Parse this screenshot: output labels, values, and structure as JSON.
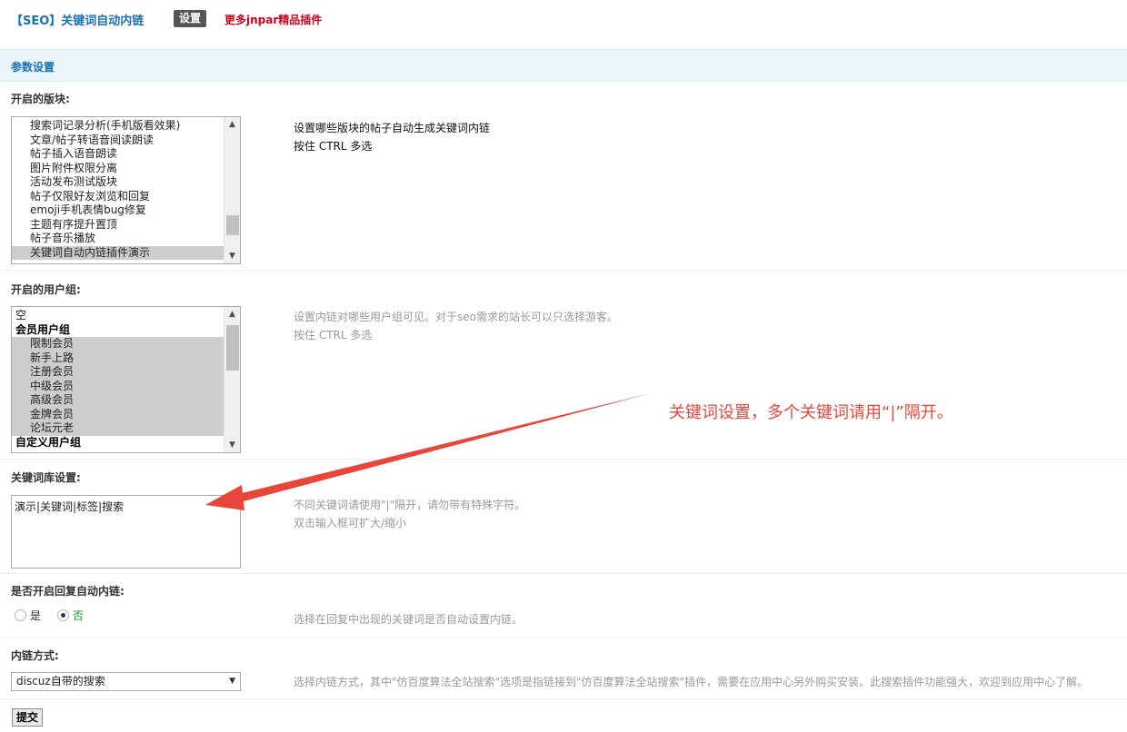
{
  "header": {
    "app_title": "【SEO】关键词自动内链",
    "tab_settings": "设置",
    "more_plugins": "更多jnpar精品插件"
  },
  "section": {
    "title": "参数设置"
  },
  "forums": {
    "label": "开启的版块:",
    "options": [
      {
        "text": "搜索词记录分析(手机版看效果)",
        "selected": false
      },
      {
        "text": "文章/帖子转语音阅读朗读",
        "selected": false
      },
      {
        "text": "帖子插入语音朗读",
        "selected": false
      },
      {
        "text": "图片附件权限分离",
        "selected": false
      },
      {
        "text": "活动发布测试版块",
        "selected": false
      },
      {
        "text": "帖子仅限好友浏览和回复",
        "selected": false
      },
      {
        "text": "emoji手机表情bug修复",
        "selected": false
      },
      {
        "text": "主题有序提升置顶",
        "selected": false
      },
      {
        "text": "帖子音乐播放",
        "selected": false
      },
      {
        "text": "关键词自动内链插件演示",
        "selected": true
      }
    ],
    "hint_line1": "设置哪些版块的帖子自动生成关键词内链",
    "hint_line2": "按住 CTRL 多选"
  },
  "usergroups": {
    "label": "开启的用户组:",
    "options": [
      {
        "text": "空",
        "kind": "plain",
        "selected": false
      },
      {
        "text": "会员用户组",
        "kind": "group",
        "selected": false
      },
      {
        "text": "限制会员",
        "kind": "item",
        "selected": true
      },
      {
        "text": "新手上路",
        "kind": "item",
        "selected": true
      },
      {
        "text": "注册会员",
        "kind": "item",
        "selected": true
      },
      {
        "text": "中级会员",
        "kind": "item",
        "selected": true
      },
      {
        "text": "高级会员",
        "kind": "item",
        "selected": true
      },
      {
        "text": "金牌会员",
        "kind": "item",
        "selected": true
      },
      {
        "text": "论坛元老",
        "kind": "item",
        "selected": true
      },
      {
        "text": "自定义用户组",
        "kind": "group",
        "selected": false
      }
    ],
    "hint_line1": "设置内链对哪些用户组可见。对于seo需求的站长可以只选择游客。",
    "hint_line2": "按住 CTRL 多选"
  },
  "keywords": {
    "label": "关键词库设置:",
    "value": "演示|关键词|标签|搜索",
    "hint_line1": "不同关键词请使用\"|\"隔开，请勿带有特殊字符。",
    "hint_line2": "双击输入框可扩大/缩小"
  },
  "reply_links": {
    "label": "是否开启回复自动内链:",
    "option_yes": "是",
    "option_no": "否",
    "selected": "否",
    "hint": "选择在回复中出现的关键词是否自动设置内链。"
  },
  "link_mode": {
    "label": "内链方式:",
    "selected": "discuz自带的搜索",
    "hint": "选择内链方式，其中\"仿百度算法全站搜索\"选项是指链接到\"仿百度算法全站搜索\"插件，需要在应用中心另外购买安装。此搜索插件功能强大，欢迎到应用中心了解。"
  },
  "submit_label": "提交",
  "annotation": {
    "text": "关键词设置，多个关键词请用“|”隔开。",
    "color": "#e8463b"
  },
  "colors": {
    "accent_blue": "#1a73b5",
    "link_red": "#d0021b",
    "section_bg": "#eaf4fb",
    "selected_green": "#0a9a2c"
  }
}
